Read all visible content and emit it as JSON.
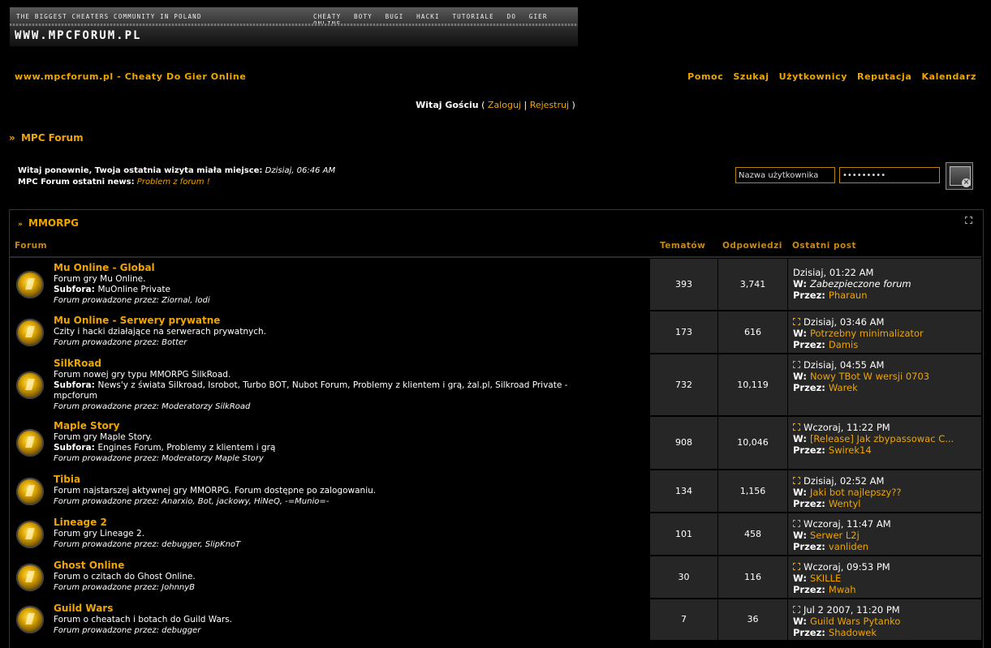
{
  "banner": {
    "tagline": "The biggest cheaters community in Poland",
    "menu": "Cheaty Boty Bugi Hacki Tutoriale do gier online",
    "logo": "WWW.MPCFORUM.PL"
  },
  "header": {
    "site_link": "www.mpcforum.pl - Cheaty Do Gier Online",
    "nav": [
      "Pomoc",
      "Szukaj",
      "Użytkownicy",
      "Reputacja",
      "Kalendarz"
    ]
  },
  "welcome": {
    "greeting": "Witaj Gościu",
    "open": "(",
    "login": "Zaloguj",
    "sep": "|",
    "register": "Rejestruj",
    "close": ")"
  },
  "breadcrumb": {
    "arrow": "»",
    "title": "MPC Forum"
  },
  "info": {
    "last_visit_label": "Witaj ponownie, Twoja ostatnia wizyta miała miejsce:",
    "last_visit_value": "Dzisiaj, 06:46 AM",
    "news_label": "MPC Forum ostatni news:",
    "news_value": "Problem z forum !"
  },
  "login": {
    "username_placeholder": "Nazwa użytkownika",
    "password_value": "•••••••••"
  },
  "category": {
    "arrow": "»",
    "title": "MMORPG"
  },
  "columns": {
    "forum": "Forum",
    "topics": "Tematów",
    "replies": "Odpowiedzi",
    "last_post": "Ostatni post"
  },
  "labels": {
    "subfora": "Subfora:",
    "mod": "Forum prowadzone przez:",
    "w": "W:",
    "by": "Przez:"
  },
  "forums": [
    {
      "name": "Mu Online - Global",
      "desc": "Forum gry Mu Online.",
      "sub": "MuOnline Private",
      "mods": "Ziornal, lodi",
      "topics": "393",
      "replies": "3,741",
      "date": "Dzisiaj, 01:22 AM",
      "post": "Zabezpieczone forum",
      "user": "Pharaun"
    },
    {
      "name": "Mu Online - Serwery prywatne",
      "desc": "Czity i hacki działające na serwerach prywatnych.",
      "sub": "",
      "mods": "Botter",
      "topics": "173",
      "replies": "616",
      "date": "Dzisiaj, 03:46 AM",
      "post": "Potrzebny minimalizator",
      "user": "Damis"
    },
    {
      "name": "SilkRoad",
      "desc": "Forum nowej gry typu MMORPG SilkRoad.",
      "sub": "News'y z świata Silkroad, Isrobot, Turbo BOT, Nubot Forum, Problemy z klientem i grą, żal.pl, Silkroad Private - mpcforum",
      "mods": "Moderatorzy SilkRoad",
      "topics": "732",
      "replies": "10,119",
      "date": "Dzisiaj, 04:55 AM",
      "post": "Nowy TBot W wersji 0703",
      "user": "Warek"
    },
    {
      "name": "Maple Story",
      "desc": "Forum gry Maple Story.",
      "sub": "Engines Forum, Problemy z klientem i grą",
      "mods": "Moderatorzy Maple Story",
      "topics": "908",
      "replies": "10,046",
      "date": "Wczoraj, 11:22 PM",
      "post": "[Release] Jak zbypassowac C...",
      "user": "Swirek14"
    },
    {
      "name": "Tibia",
      "desc": "Forum najstarszej aktywnej gry MMORPG. Forum dostępne po zalogowaniu.",
      "sub": "",
      "mods": "Anarxio, Bot, jackowy, HiNeQ, -=Munio=-",
      "topics": "134",
      "replies": "1,156",
      "date": "Dzisiaj, 02:52 AM",
      "post": "Jaki bot najlepszy??",
      "user": "Wentyl"
    },
    {
      "name": "Lineage 2",
      "desc": "Forum gry Lineage 2.",
      "sub": "",
      "mods": "debugger, SlipKnoT",
      "topics": "101",
      "replies": "458",
      "date": "Wczoraj, 11:47 AM",
      "post": "Serwer L2j",
      "user": "vanliden"
    },
    {
      "name": "Ghost Online",
      "desc": "Forum o czitach do Ghost Online.",
      "sub": "",
      "mods": "JohnnyB",
      "topics": "30",
      "replies": "116",
      "date": "Wczoraj, 09:53 PM",
      "post": "SKILLE",
      "user": "Mwah"
    },
    {
      "name": "Guild Wars",
      "desc": "Forum o cheatach i botach do Guild Wars.",
      "sub": "",
      "mods": "debugger",
      "topics": "7",
      "replies": "36",
      "date": "Jul 2 2007, 11:20 PM",
      "post": "Guild Wars Pytanko",
      "user": "Shadowek"
    }
  ]
}
